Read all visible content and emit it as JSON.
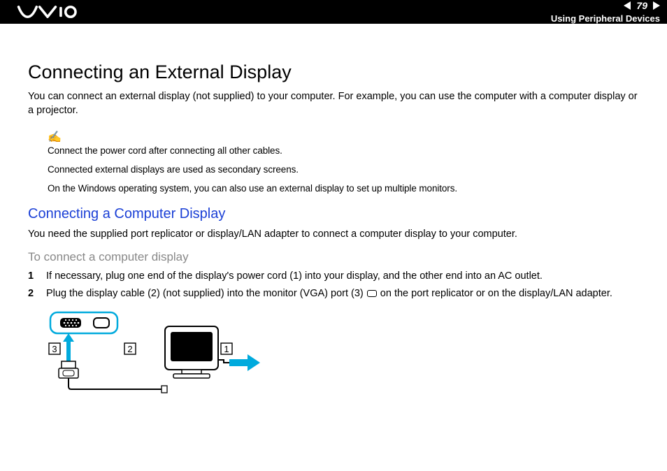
{
  "header": {
    "page_number": "79",
    "section": "Using Peripheral Devices"
  },
  "title": "Connecting an External Display",
  "intro": "You can connect an external display (not supplied) to your computer. For example, you can use the computer with a computer display or a projector.",
  "notes": {
    "line1": "Connect the power cord after connecting all other cables.",
    "line2": "Connected external displays are used as secondary screens.",
    "line3": "On the Windows operating system, you can also use an external display to set up multiple monitors."
  },
  "subheading": "Connecting a Computer Display",
  "sub_intro": "You need the supplied port replicator or display/LAN adapter to connect a computer display to your computer.",
  "procedure_heading": "To connect a computer display",
  "steps": {
    "s1": "If necessary, plug one end of the display's power cord (1) into your display, and the other end into an AC outlet.",
    "s2a": "Plug the display cable (2) (not supplied) into the monitor (VGA) port (3) ",
    "s2b": " on the port replicator or on the display/LAN adapter."
  },
  "diagram_labels": {
    "l1": "1",
    "l2": "2",
    "l3": "3"
  }
}
